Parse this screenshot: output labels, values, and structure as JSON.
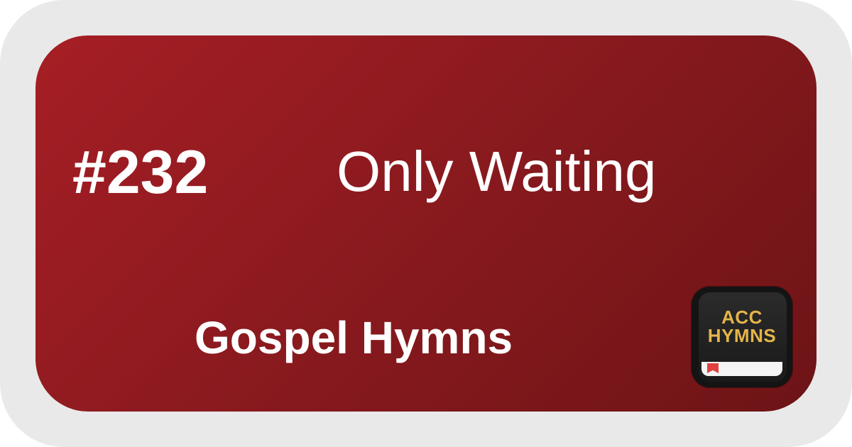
{
  "hymn": {
    "number": "#232",
    "title": "Only Waiting",
    "collection": "Gospel Hymns"
  },
  "app_icon": {
    "line1": "ACC",
    "line2": "HYMNS",
    "icon_name": "acc-hymns-app-icon"
  },
  "colors": {
    "frame": "#e9e9e9",
    "card_start": "#a61e25",
    "card_end": "#6d1416",
    "text": "#ffffff",
    "logo_gold": "#e4b54a",
    "ribbon": "#e0413e"
  }
}
